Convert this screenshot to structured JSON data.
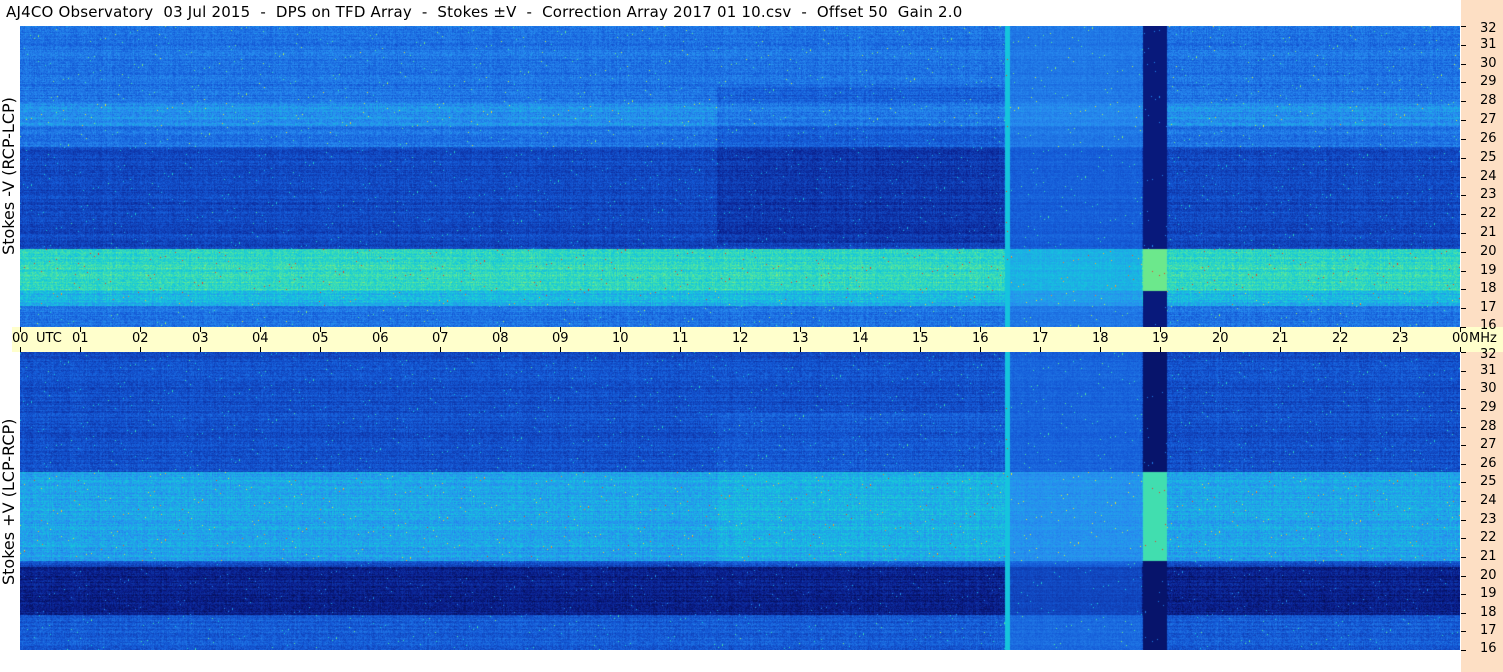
{
  "title": "AJ4CO Observatory  03 Jul 2015  -  DPS on TFD Array  -  Stokes ±V  -  Correction Array 2017 01 10.csv  -  Offset 50  Gain 2.0",
  "chart_data": {
    "type": "heatmap",
    "panels": [
      {
        "ylabel": "Stokes -V (RCP-LCP)",
        "y_unit": "MHz",
        "ylim": [
          16,
          32
        ],
        "colormap": "blue-cyan-yellow-red"
      },
      {
        "ylabel": "Stokes +V (LCP-RCP)",
        "y_unit": "MHz",
        "ylim": [
          16,
          32
        ],
        "colormap": "blue-cyan-yellow-red"
      }
    ],
    "x_ticks": [
      "00",
      "01",
      "02",
      "03",
      "04",
      "05",
      "06",
      "07",
      "08",
      "09",
      "10",
      "11",
      "12",
      "13",
      "14",
      "15",
      "16",
      "17",
      "18",
      "19",
      "20",
      "21",
      "22",
      "23",
      "00"
    ],
    "x_unit": "UTC",
    "y_unit_label": "MHz",
    "y_ticks": [
      "16",
      "17",
      "18",
      "19",
      "20",
      "21",
      "22",
      "23",
      "24",
      "25",
      "26",
      "27",
      "28",
      "29",
      "30",
      "31",
      "32"
    ],
    "xlim_hours": [
      0,
      24
    ]
  }
}
